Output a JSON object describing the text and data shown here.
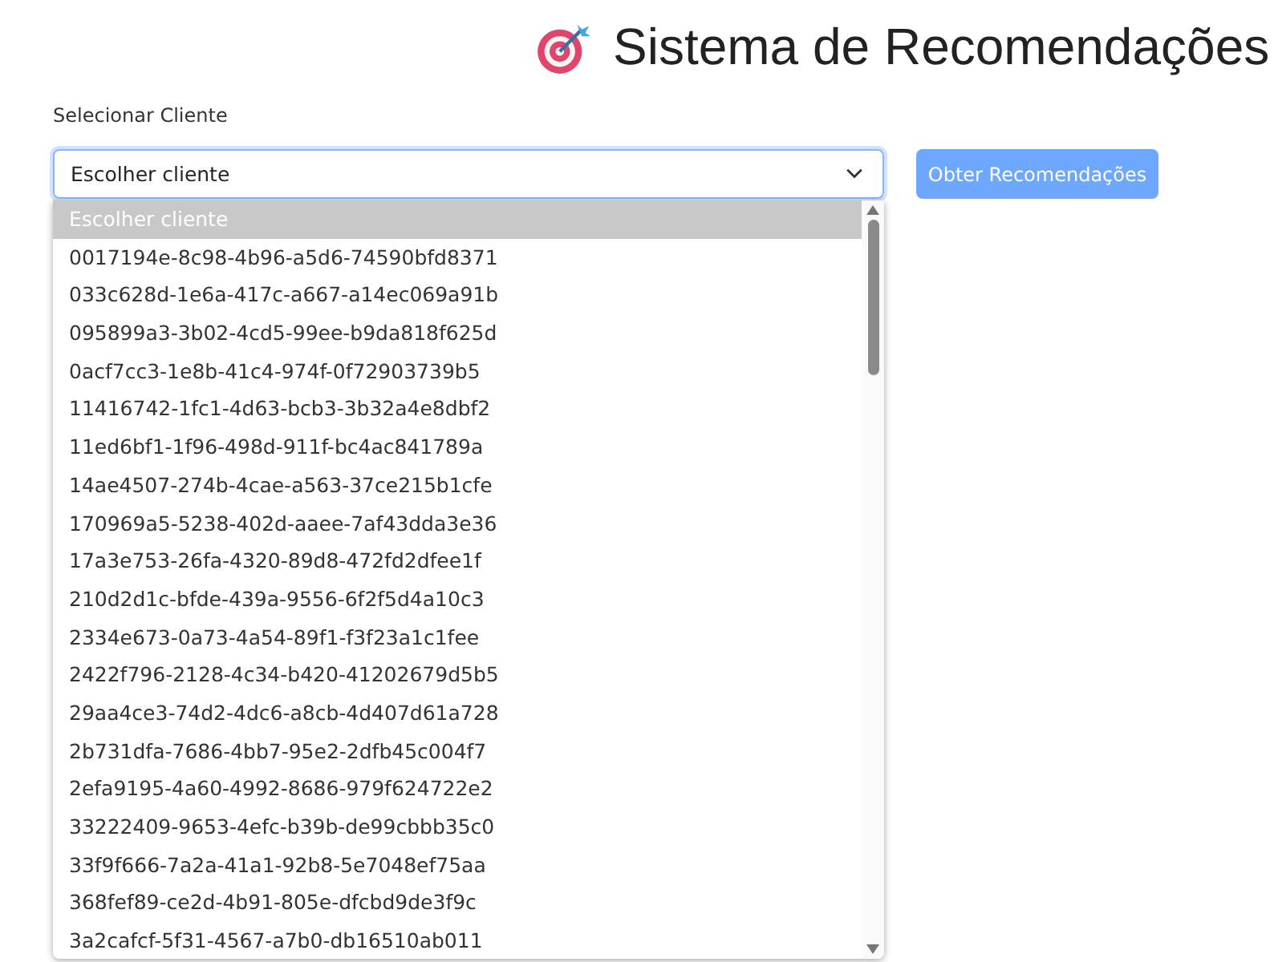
{
  "header": {
    "title": "Sistema de Recomendações"
  },
  "form": {
    "label": "Selecionar Cliente",
    "select": {
      "value": "Escolher cliente",
      "expanded": true
    },
    "button": "Obter Recomendações"
  },
  "dropdown": {
    "options": [
      {
        "label": "Escolher cliente",
        "selected": true
      },
      {
        "label": "0017194e-8c98-4b96-a5d6-74590bfd8371",
        "selected": false
      },
      {
        "label": "033c628d-1e6a-417c-a667-a14ec069a91b",
        "selected": false
      },
      {
        "label": "095899a3-3b02-4cd5-99ee-b9da818f625d",
        "selected": false
      },
      {
        "label": "0acf7cc3-1e8b-41c4-974f-0f72903739b5",
        "selected": false
      },
      {
        "label": "11416742-1fc1-4d63-bcb3-3b32a4e8dbf2",
        "selected": false
      },
      {
        "label": "11ed6bf1-1f96-498d-911f-bc4ac841789a",
        "selected": false
      },
      {
        "label": "14ae4507-274b-4cae-a563-37ce215b1cfe",
        "selected": false
      },
      {
        "label": "170969a5-5238-402d-aaee-7af43dda3e36",
        "selected": false
      },
      {
        "label": "17a3e753-26fa-4320-89d8-472fd2dfee1f",
        "selected": false
      },
      {
        "label": "210d2d1c-bfde-439a-9556-6f2f5d4a10c3",
        "selected": false
      },
      {
        "label": "2334e673-0a73-4a54-89f1-f3f23a1c1fee",
        "selected": false
      },
      {
        "label": "2422f796-2128-4c34-b420-41202679d5b5",
        "selected": false
      },
      {
        "label": "29aa4ce3-74d2-4dc6-a8cb-4d407d61a728",
        "selected": false
      },
      {
        "label": "2b731dfa-7686-4bb7-95e2-2dfb45c004f7",
        "selected": false
      },
      {
        "label": "2efa9195-4a60-4992-8686-979f624722e2",
        "selected": false
      },
      {
        "label": "33222409-9653-4efc-b39b-de99cbbb35c0",
        "selected": false
      },
      {
        "label": "33f9f666-7a2a-41a1-92b8-5e7048ef75aa",
        "selected": false
      },
      {
        "label": "368fef89-ce2d-4b91-805e-dfcbd9de3f9c",
        "selected": false
      },
      {
        "label": "3a2cafcf-5f31-4567-a7b0-db16510ab011",
        "selected": false
      }
    ]
  }
}
